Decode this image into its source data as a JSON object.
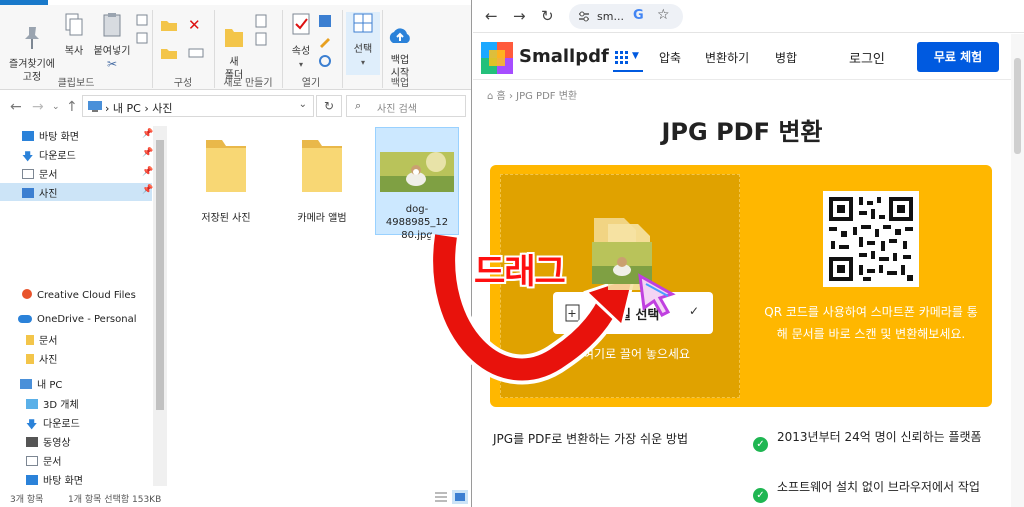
{
  "explorer": {
    "ribbon": {
      "pin_label": "즐겨찾기에\n고정",
      "copy_label": "복사",
      "paste_label": "붙여넣기",
      "group_clipboard": "클립보드",
      "group_organize": "구성",
      "new_folder_label": "새\n폴더",
      "group_new": "새로 만들기",
      "properties_label": "속성",
      "group_open": "열기",
      "select_label": "선택",
      "backup_label": "백업\n시작",
      "group_backup": "백업"
    },
    "address": {
      "path": "› 내 PC › 사진",
      "search_placeholder": "사진 검색"
    },
    "nav": {
      "quick": [
        {
          "label": "바탕 화면",
          "icon": "desktop-icon"
        },
        {
          "label": "다운로드",
          "icon": "download-icon"
        },
        {
          "label": "문서",
          "icon": "document-icon"
        },
        {
          "label": "사진",
          "icon": "pictures-icon"
        }
      ],
      "creative_cloud": "Creative Cloud Files",
      "onedrive": "OneDrive - Personal",
      "onedrive_items": [
        "문서",
        "사진"
      ],
      "this_pc": "내 PC",
      "pc_items": [
        "3D 개체",
        "다운로드",
        "동영상",
        "문서",
        "바탕 화면"
      ]
    },
    "files": [
      {
        "name": "저장된 사진",
        "type": "folder"
      },
      {
        "name": "카메라 앨범",
        "type": "folder"
      },
      {
        "name": "dog-4988985_12\n80.jpg",
        "type": "image"
      }
    ],
    "status": {
      "count": "3개 항목",
      "selection": "1개 항목 선택함 153KB"
    }
  },
  "browser": {
    "omnibox_text": "sm...",
    "site": {
      "brand": "Smallpdf",
      "nav": [
        "압축",
        "변환하기",
        "병합"
      ],
      "login": "로그인",
      "free_trial": "무료 체험",
      "breadcrumb_home": "홈",
      "breadcrumb_current": "JPG PDF 변환",
      "title": "JPG PDF 변환",
      "choose_file": "파일 선택",
      "drop_hint": "여기로 끌어 놓으세요",
      "qr_text": "QR 코드를 사용하여 스마트폰 카메라를 통해 문서를 바로 스캔 및 변환해보세요.",
      "how_title": "JPG를 PDF로 변환하는 가장 쉬운 방법",
      "features": [
        "2013년부터 24억 명이 신뢰하는 플랫폼",
        "소프트웨어 설치 없이 브라우저에서 작업"
      ]
    }
  },
  "overlay": {
    "drag_label": "드래그"
  },
  "colors": {
    "accent_blue": "#005ae0",
    "drop_yellow": "#ffb700",
    "arrow_red": "#e8120c",
    "check_green": "#1fb652"
  }
}
